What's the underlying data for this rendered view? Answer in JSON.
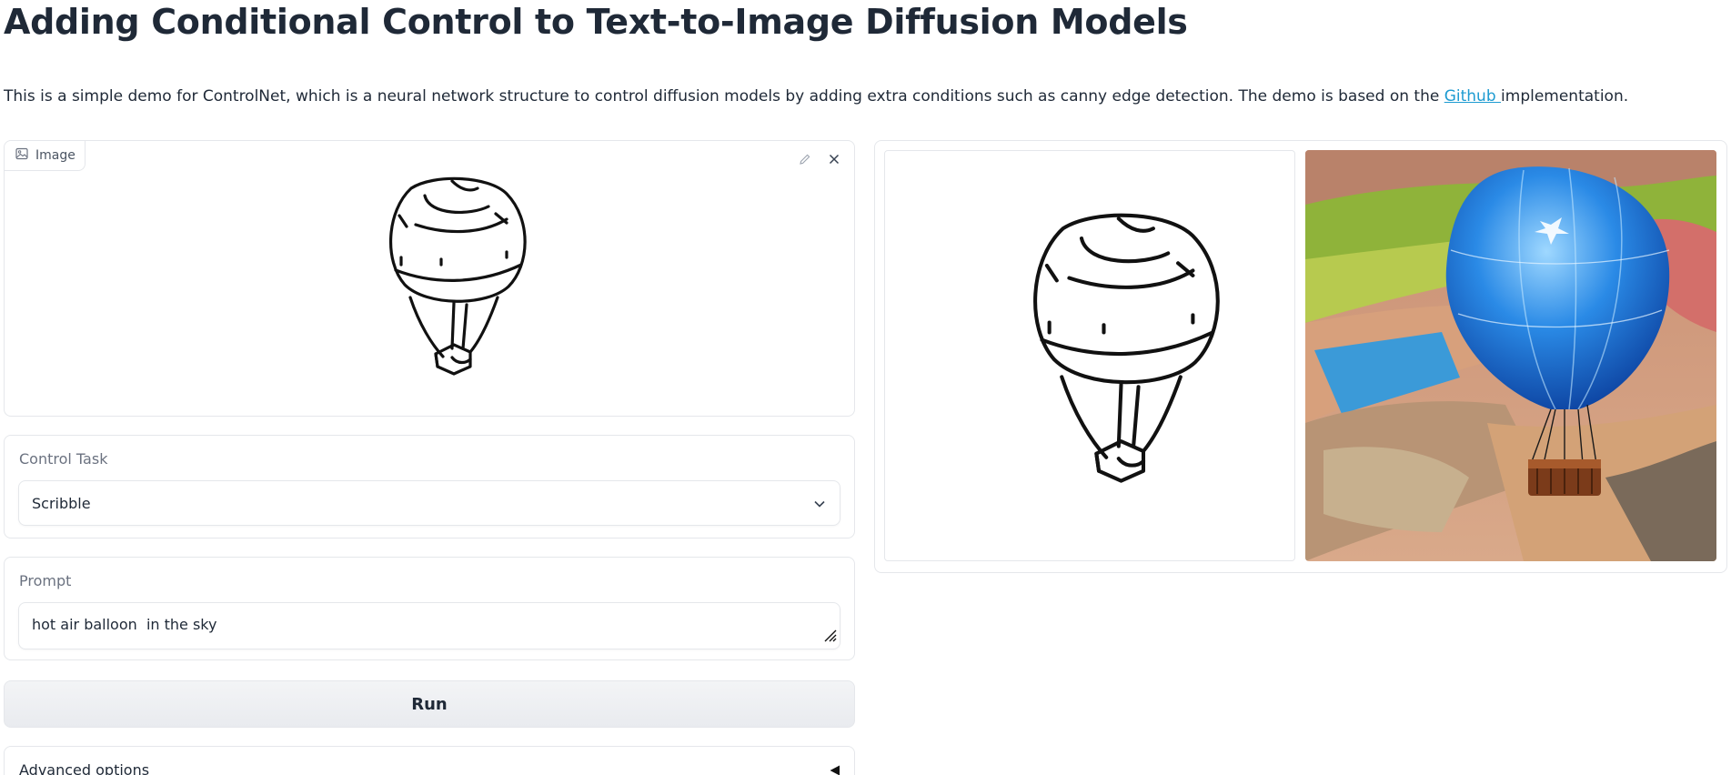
{
  "header": {
    "title": "Adding Conditional Control to Text-to-Image Diffusion Models",
    "description_before": "This is a simple demo for ControlNet, which is a neural network structure to control diffusion models by adding extra conditions such as canny edge detection. The demo is based on the ",
    "link_text": "Github ",
    "description_after": "implementation."
  },
  "image_input": {
    "label": "Image",
    "icons": [
      "image-icon",
      "pencil-icon",
      "close-icon"
    ]
  },
  "control_task": {
    "label": "Control Task",
    "selected": "Scribble"
  },
  "prompt": {
    "label": "Prompt",
    "value": "hot air balloon  in the sky"
  },
  "run_button": {
    "label": "Run"
  },
  "advanced": {
    "label": "Advanced options"
  },
  "colors": {
    "accent_link": "#1d9bd1",
    "border": "#e5e7eb",
    "label": "#6b7280",
    "balloon_blue": "#1e78d8"
  }
}
